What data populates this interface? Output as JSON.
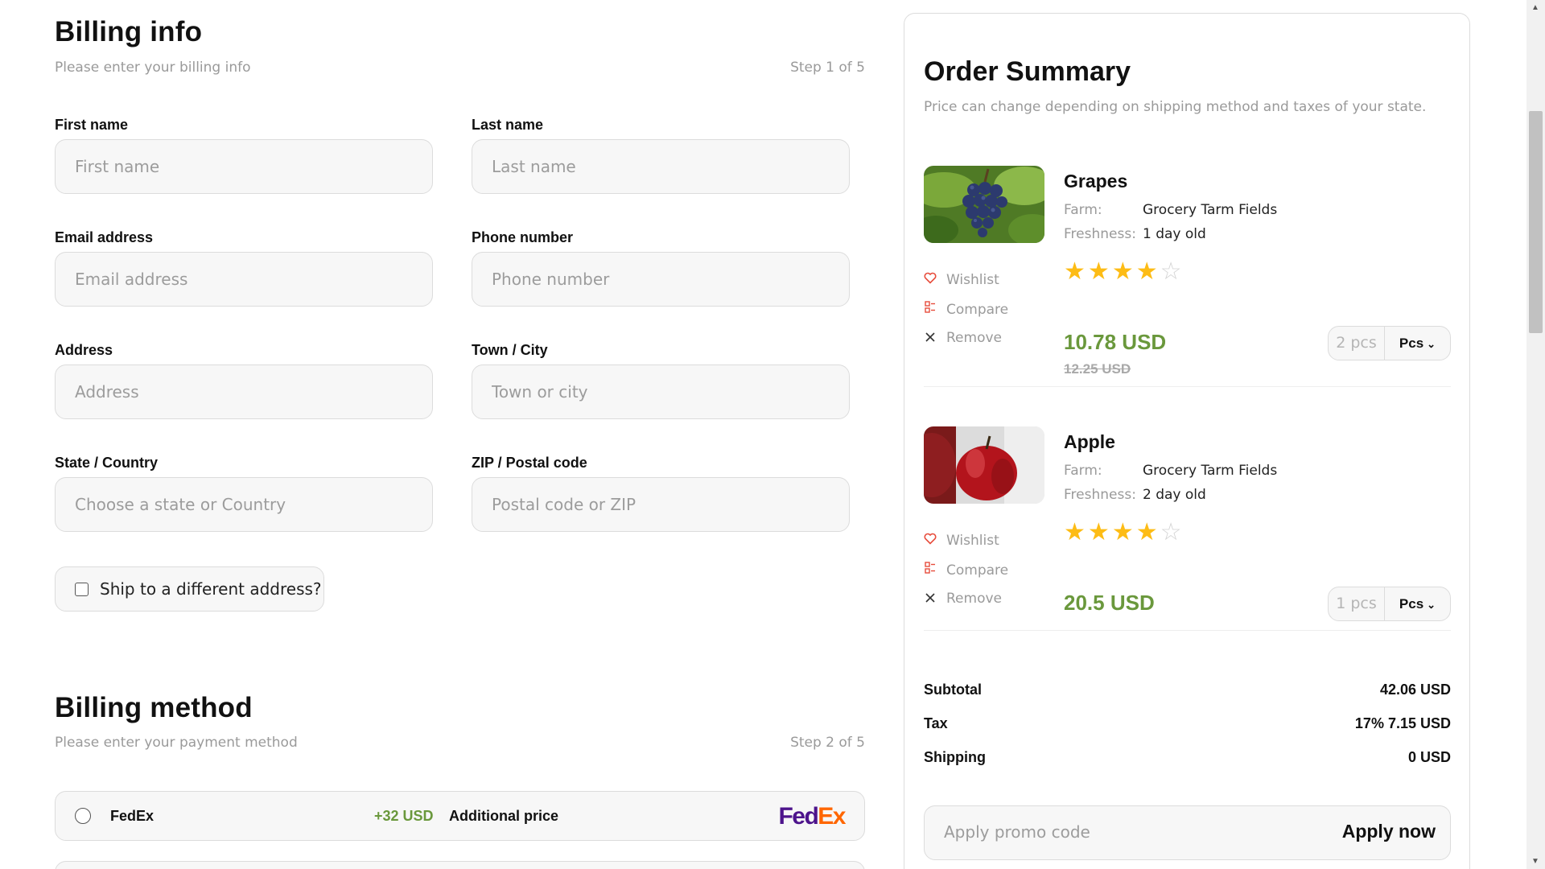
{
  "billing_info": {
    "title": "Billing info",
    "subtitle": "Please enter your billing info",
    "step": "Step 1 of 5",
    "fields": {
      "first_name": {
        "label": "First name",
        "placeholder": "First name"
      },
      "last_name": {
        "label": "Last name",
        "placeholder": "Last name"
      },
      "email": {
        "label": "Email address",
        "placeholder": "Email address"
      },
      "phone": {
        "label": "Phone number",
        "placeholder": "Phone number"
      },
      "address": {
        "label": "Address",
        "placeholder": "Address"
      },
      "city": {
        "label": "Town / City",
        "placeholder": "Town or city"
      },
      "state": {
        "label": "State / Country",
        "placeholder": "Choose a state or Country"
      },
      "zip": {
        "label": "ZIP / Postal code",
        "placeholder": "Postal code or ZIP"
      }
    },
    "ship_different": {
      "label": "Ship to a different address?",
      "checked": false
    }
  },
  "billing_method": {
    "title": "Billing method",
    "subtitle": "Please enter your payment method",
    "step": "Step 2 of 5",
    "options": [
      {
        "name": "FedEx",
        "price": "+32 USD",
        "price_label": "Additional price",
        "logo_a": "Fed",
        "logo_b": "Ex",
        "selected": false
      }
    ]
  },
  "order_summary": {
    "title": "Order Summary",
    "subtitle": "Price can change depending on shipping method and taxes of your state.",
    "actions": {
      "wishlist": "Wishlist",
      "compare": "Compare",
      "remove": "Remove"
    },
    "meta_labels": {
      "farm": "Farm:",
      "freshness": "Freshness:"
    },
    "products": [
      {
        "name": "Grapes",
        "farm": "Grocery Tarm Fields",
        "freshness": "1 day old",
        "rating": 4,
        "rating_max": 5,
        "price": "10.78 USD",
        "old_price": "12.25 USD",
        "qty": "2 pcs",
        "unit": "Pcs"
      },
      {
        "name": "Apple",
        "farm": "Grocery Tarm Fields",
        "freshness": "2 day old",
        "rating": 4,
        "rating_max": 5,
        "price": "20.5 USD",
        "qty": "1 pcs",
        "unit": "Pcs"
      }
    ],
    "totals": {
      "subtotal_label": "Subtotal",
      "subtotal": "42.06 USD",
      "tax_label": "Tax",
      "tax": "17% 7.15 USD",
      "shipping_label": "Shipping",
      "shipping": "0 USD"
    },
    "promo": {
      "placeholder": "Apply promo code",
      "button": "Apply now"
    }
  },
  "colors": {
    "accent_green": "#6a983c",
    "star": "#fdbc15",
    "fedex_purple": "#4d148c",
    "fedex_orange": "#ff6600",
    "heart": "#e74c3c"
  },
  "icons": [
    "heart-icon",
    "compare-icon",
    "close-icon",
    "chevron-down-icon",
    "star-icon"
  ]
}
